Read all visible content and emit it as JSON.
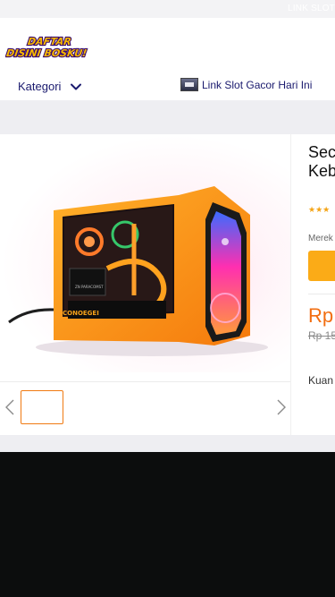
{
  "topbar": {
    "link_text": "LINK SLOT"
  },
  "header": {
    "logo_line1": "DAFTAR",
    "logo_line2": "DISINI BOSKU!",
    "kategori_label": "Kategori",
    "slot_link_label": "Link Slot Gacor Hari Ini"
  },
  "product": {
    "image_alt": "Gaming PC case orange",
    "title_line1": "Sec",
    "title_line2": "Keb",
    "rating_stars": 3,
    "stars_text": "★★★",
    "brand_label": "Merek",
    "price": "Rp",
    "old_price": "Rp 15",
    "quantity_label": "Kuan",
    "case_brand_text": "CONOEGEI",
    "case_sub_text": "ZN PARACOMST"
  },
  "colors": {
    "accent_orange": "#f26e11",
    "button_yellow": "#fbab17",
    "navy_text": "#1a1a6e",
    "footer": "#0c0d0d"
  }
}
